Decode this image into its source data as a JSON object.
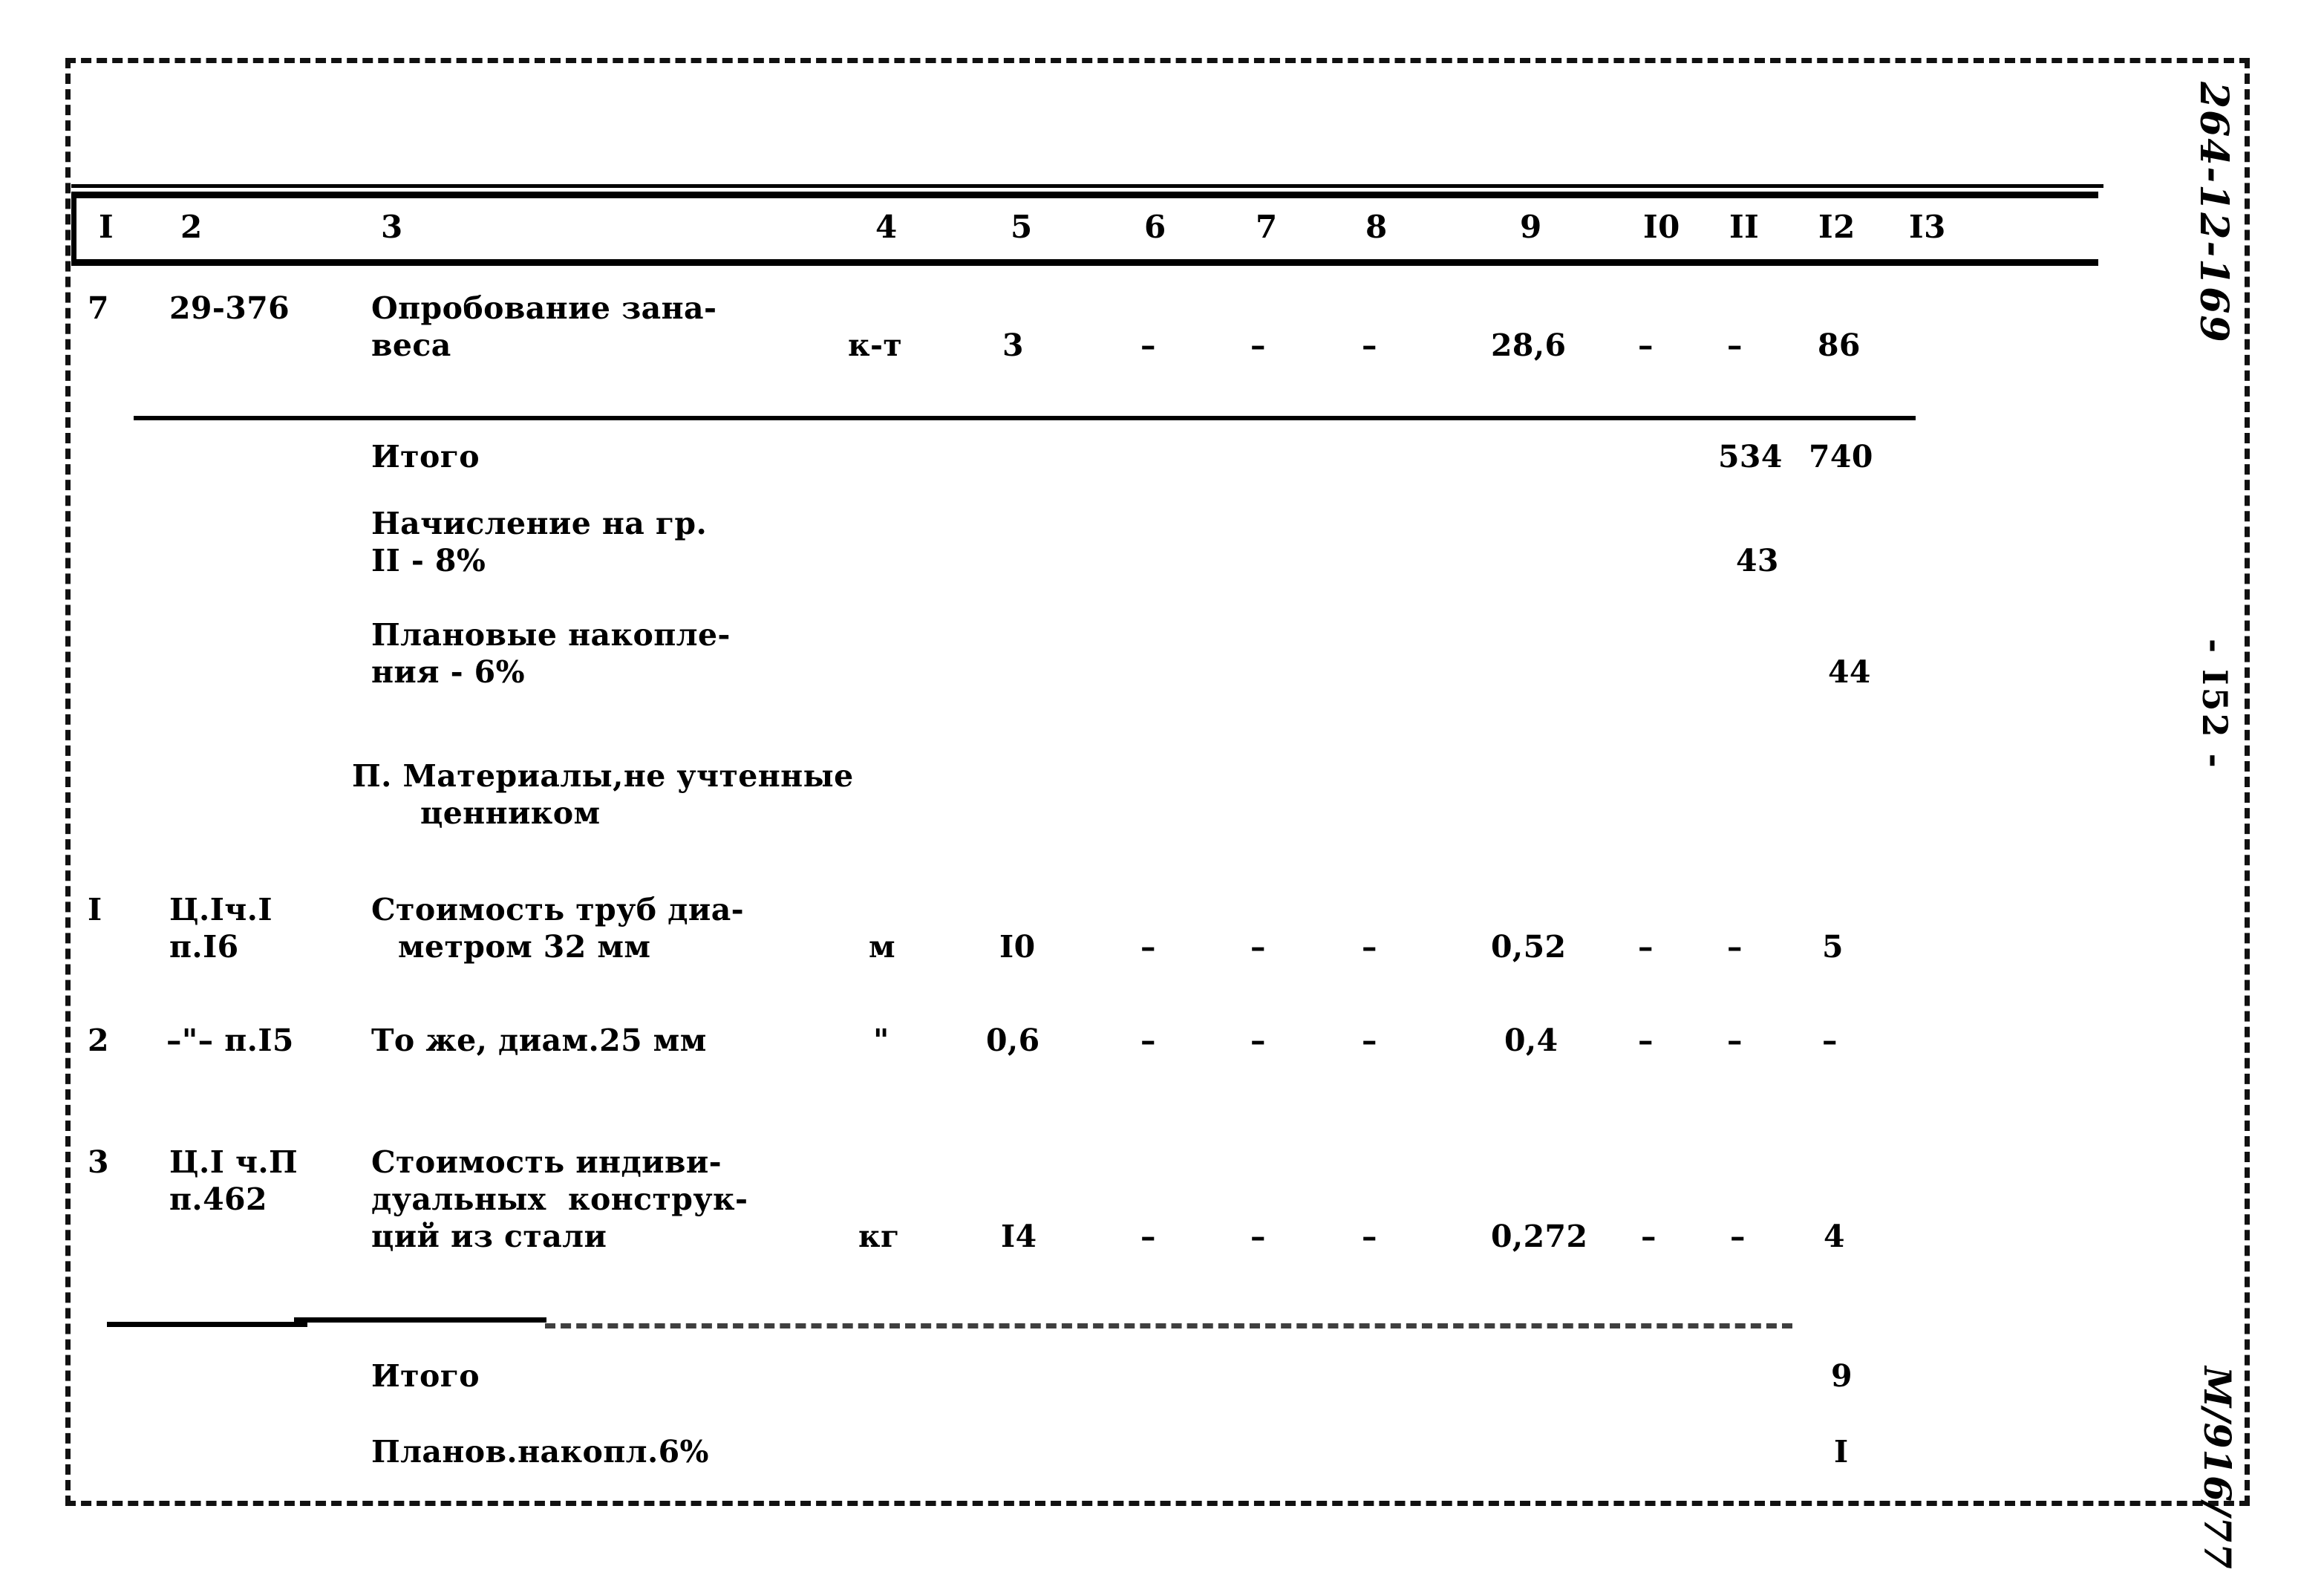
{
  "document": {
    "doc_code": "264-12-169",
    "page_number": "- I52 -",
    "stamp": "М/916/77"
  },
  "table": {
    "column_headers": [
      "I",
      "2",
      "3",
      "4",
      "5",
      "6",
      "7",
      "8",
      "9",
      "I0",
      "II",
      "I2",
      "I3"
    ],
    "rows": [
      {
        "kind": "data",
        "num": "7",
        "code": "29-376",
        "desc_line1": "Опробование зана-",
        "desc_line2": "веса",
        "unit": "к-т",
        "qty": "3",
        "c6": "–",
        "c7": "–",
        "c8": "–",
        "c9": "28,6",
        "c10": "–",
        "c11": "–",
        "c12": "86",
        "c13": ""
      },
      {
        "kind": "total",
        "label": "Итого",
        "c11": "534",
        "c12": "740"
      },
      {
        "kind": "total",
        "label_line1": "Начисление на гр.",
        "label_line2": "II - 8%",
        "c11": "43",
        "c12": ""
      },
      {
        "kind": "total",
        "label_line1": "Плановые накопле-",
        "label_line2": "ния - 6%",
        "c11": "",
        "c12": "44"
      },
      {
        "kind": "section",
        "title_line1": "П. Материалы,не учтенные",
        "title_line2": "ценником"
      },
      {
        "kind": "data",
        "num": "I",
        "code_line1": "Ц.Iч.I",
        "code_line2": "п.I6",
        "desc_line1": "Стоимость труб диа-",
        "desc_line2": "метром 32 мм",
        "unit": "м",
        "qty": "I0",
        "c6": "–",
        "c7": "–",
        "c8": "–",
        "c9": "0,52",
        "c10": "–",
        "c11": "–",
        "c12": "5",
        "c13": ""
      },
      {
        "kind": "data",
        "num": "2",
        "code_line1": "–\"– п.I5",
        "code_line2": "",
        "desc_line1": "То же, диам.25 мм",
        "desc_line2": "",
        "unit": "\"",
        "qty": "0,6",
        "c6": "–",
        "c7": "–",
        "c8": "–",
        "c9": "0,4",
        "c10": "–",
        "c11": "–",
        "c12": "–",
        "c13": ""
      },
      {
        "kind": "data",
        "num": "3",
        "code_line1": "Ц.I ч.П",
        "code_line2": "п.462",
        "desc_line1": "Стоимость индиви-",
        "desc_line2": "дуальных  конструк-",
        "desc_line3": "ций из стали",
        "unit": "кг",
        "qty": "I4",
        "c6": "–",
        "c7": "–",
        "c8": "–",
        "c9": "0,272",
        "c10": "–",
        "c11": "–",
        "c12": "4",
        "c13": ""
      },
      {
        "kind": "total",
        "label": "Итого",
        "c12": "9"
      },
      {
        "kind": "total",
        "label": "Планов.накопл.6%",
        "c12": "I"
      }
    ]
  }
}
